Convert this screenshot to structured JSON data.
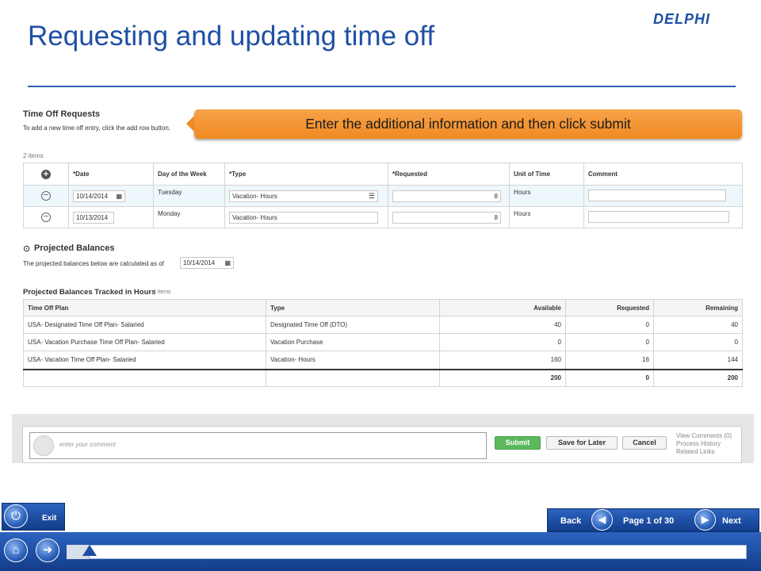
{
  "slide": {
    "title": "Requesting and updating time off",
    "logo_text": "DELPHI",
    "callout": "Enter the additional information and then click submit"
  },
  "time_off": {
    "title": "Time Off Requests",
    "subtitle": "To add a new time off entry, click the add row button.",
    "count": "2 items",
    "columns": [
      "*Date",
      "Day of the Week",
      "*Type",
      "*Requested",
      "Unit of Time",
      "Comment"
    ],
    "rows": [
      {
        "date": "10/14/2014",
        "day": "Tuesday",
        "type": "Vacation- Hours",
        "requested": "8",
        "unit": "Hours",
        "comment": ""
      },
      {
        "date": "10/13/2014",
        "day": "Monday",
        "type": "Vacation- Hours",
        "requested": "8",
        "unit": "Hours",
        "comment": ""
      }
    ]
  },
  "projected": {
    "title": "Projected Balances",
    "calc_label": "The projected balances below are calculated as of",
    "calc_date": "10/14/2014",
    "tracked_title": "Projected Balances Tracked in Hours",
    "tracked_count": "4 items",
    "columns": [
      "Time Off Plan",
      "Type",
      "Available",
      "Requested",
      "Remaining"
    ],
    "rows": [
      {
        "plan": "USA- Designated Time Off Plan- Salaried",
        "type": "Designated Time Off (DTO)",
        "available": "40",
        "requested": "0",
        "remaining": "40"
      },
      {
        "plan": "USA- Vacation Purchase Time Off Plan- Salaried",
        "type": "Vacation Purchase",
        "available": "0",
        "requested": "0",
        "remaining": "0"
      },
      {
        "plan": "USA- Vacation Time Off Plan- Salaried",
        "type": "Vacation- Hours",
        "available": "160",
        "requested": "16",
        "remaining": "144"
      }
    ],
    "totals": {
      "available": "200",
      "requested": "0",
      "remaining": "200"
    }
  },
  "footer": {
    "comment_placeholder": "enter your comment",
    "submit": "Submit",
    "save_for_later": "Save for Later",
    "cancel": "Cancel",
    "links": [
      "View Comments (0)",
      "Process History",
      "Related Links"
    ]
  },
  "nav": {
    "exit": "Exit",
    "back": "Back",
    "page": "Page 1 of 30",
    "next": "Next",
    "progress_fraction": 0.0333
  },
  "colors": {
    "title_blue": "#1f4fa3",
    "callout_orange": "#f08a22",
    "submit_green": "#5cb85c",
    "selected_row": "#eef7fb",
    "nav_blue": "#1a4aa0"
  }
}
